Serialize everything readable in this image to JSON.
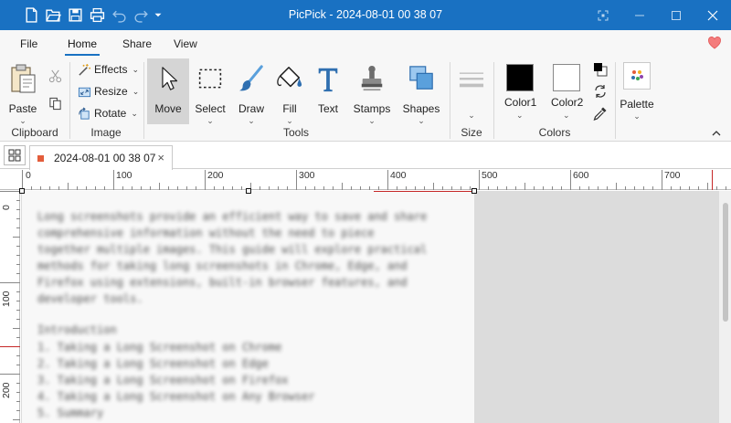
{
  "window": {
    "title": "PicPick - 2024-08-01 00 38 07",
    "titlebar_color": "#1971c2"
  },
  "quick_access": {
    "icons": [
      "new-file-icon",
      "open-folder-icon",
      "save-icon",
      "print-icon",
      "undo-icon",
      "redo-icon",
      "customize-dropdown-icon"
    ]
  },
  "menu": {
    "tabs": [
      {
        "label": "File"
      },
      {
        "label": "Home",
        "active": true
      },
      {
        "label": "Share"
      },
      {
        "label": "View"
      }
    ]
  },
  "ribbon": {
    "clipboard": {
      "label": "Clipboard",
      "paste": "Paste"
    },
    "image": {
      "label": "Image",
      "effects": "Effects",
      "resize": "Resize",
      "rotate": "Rotate"
    },
    "tools": {
      "label": "Tools",
      "move": "Move",
      "select": "Select",
      "draw": "Draw",
      "fill": "Fill",
      "text": "Text",
      "stamps": "Stamps",
      "shapes": "Shapes"
    },
    "size": {
      "label": "Size"
    },
    "colors": {
      "label": "Colors",
      "color1": "Color1",
      "color2": "Color2",
      "color1_value": "#000000",
      "color2_value": "#ffffff"
    },
    "palette": {
      "label": "Palette"
    }
  },
  "document_tab": {
    "name": "2024-08-01 00 38 07",
    "close": "×",
    "marker_color": "#e35d3b"
  },
  "ruler": {
    "top_labels": [
      "0",
      "100",
      "200",
      "300",
      "400",
      "500",
      "600",
      "700"
    ],
    "left_labels": [
      "0",
      "100",
      "200"
    ]
  },
  "document_text": {
    "lines": [
      "Long screenshots provide an efficient way to save and share",
      "comprehensive information without the need to piece",
      "together multiple images. This guide will explore practical",
      "methods for taking long screenshots in Chrome, Edge, and",
      "Firefox using extensions, built-in browser features, and",
      "developer tools.",
      "",
      "Introduction",
      "1. Taking a Long Screenshot on Chrome",
      "2. Taking a Long Screenshot on Edge",
      "3. Taking a Long Screenshot on Firefox",
      "4. Taking a Long Screenshot on Any Browser",
      "5. Summary"
    ]
  }
}
